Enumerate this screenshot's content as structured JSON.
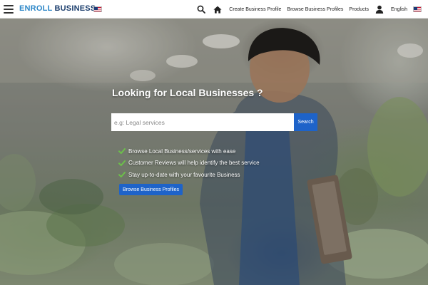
{
  "header": {
    "logo_part1": "ENROLL",
    "logo_part2": "BUSINESS",
    "nav": {
      "create": "Create Business Profile",
      "browse": "Browse Business Profiles",
      "products": "Products",
      "language": "English"
    },
    "icons": [
      "hamburger-menu-icon",
      "search-icon",
      "home-icon",
      "user-icon",
      "us-flag-icon"
    ]
  },
  "hero": {
    "title": "Looking for Local Businesses ?",
    "search": {
      "placeholder": "e.g: Legal services",
      "value": "",
      "button": "Search"
    },
    "features": [
      "Browse Local Business/services with ease",
      "Customer Reviews will help identify the best service",
      "Stay up-to-date with your favourite Business"
    ],
    "cta": "Browse Business Profiles"
  },
  "colors": {
    "accent": "#1e63c9",
    "logo_light": "#2d87c8",
    "logo_dark": "#1d3f6e",
    "check": "#6cc04a"
  }
}
